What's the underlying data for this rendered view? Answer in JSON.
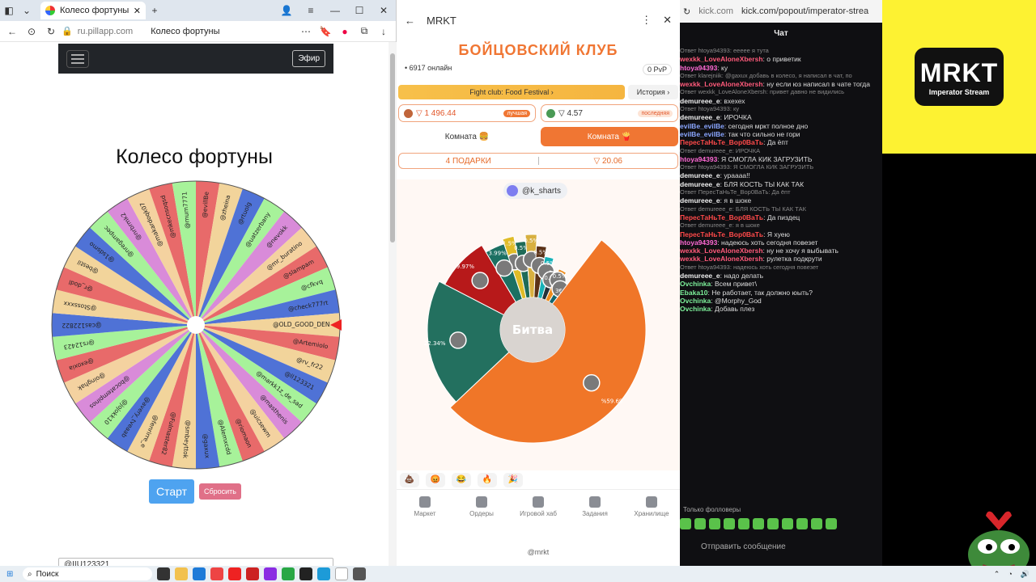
{
  "browser": {
    "tab_title": "Колесо фортуны",
    "address_url": "ru.pillapp.com",
    "address_title": "Колесо фортуны"
  },
  "page": {
    "efir_button": "Эфир",
    "wheel_title": "Колесо фортуны",
    "start_button": "Старт",
    "reset_button": "Сбросить",
    "input_value": "@IIU123321",
    "wheel_names": [
      "@evillBe",
      "@zheina",
      "@rtuolg",
      "@uatzerbany",
      "@nevokk",
      "@mr_buratino",
      "@slampam",
      "@cfkvq",
      "@check777rt",
      "@OLD_GOOD_DEN",
      "@Artemiolo",
      "@rv_fr22",
      "@ll123321",
      "@markk1z_de_sad",
      "@masthenis",
      "@uicsewm",
      "@riomaon",
      "@Alemxcdd",
      "@gaxux",
      "@smbeyttok",
      "@Fulmaster82",
      "@fenrirre_e",
      "@avery_tveaab",
      "@jojokk10",
      "@bocatempinos",
      "@oinghak",
      "@exoxia",
      "@rs12423",
      "@cas122822",
      "@Stossxxx",
      "@r_dodl",
      "@bestil",
      "@1sdsmo",
      "@nregampec",
      "@nrbrmk2",
      "@makardoqk07",
      "@mkecnsoqsd",
      "@mum7771"
    ],
    "wheel_colors": [
      "#e86a6a",
      "#f2d49b",
      "#4f72d6",
      "#a7f29a",
      "#d98bd9",
      "#f4d2a0",
      "#e86a6a",
      "#a7f29a",
      "#4f72d6",
      "#f2d49b"
    ]
  },
  "mrkt": {
    "title": "MRKT",
    "club_title": "БОЙЦОВСКИЙ КЛУБ",
    "online": "• 6917 онлайн",
    "pvp": "0 PvP",
    "promo": "Fight club: Food Festival",
    "history": "История",
    "balance_left": "▽ 1 496.44",
    "balance_left_badge": "лучшая",
    "balance_right": "▽ 4.57",
    "balance_right_badge": "последняя",
    "room_a": "Комната",
    "room_b": "Комната",
    "gifts": "4 ПОДАРКИ",
    "gifts_total": "▽ 20.06",
    "user_tag": "@k_sharts",
    "battle_label": "Битва",
    "segments": [
      {
        "label": "1.5%",
        "color": "#e0bc28",
        "value": 1.5
      },
      {
        "label": "0.5%",
        "color": "#1f6b58",
        "value": 0.5
      },
      {
        "label": "0.5%",
        "color": "#d8b040",
        "value": 0.5
      },
      {
        "label": "0.5%",
        "color": "#5b3217",
        "value": 0.5
      },
      {
        "label": "0.5%",
        "color": "#16b1b7",
        "value": 0.5
      },
      {
        "label": "0.5%",
        "color": "#23323a",
        "value": 0.5
      },
      {
        "label": "0.5%",
        "color": "#ec8c1f",
        "value": 0.5
      },
      {
        "label": "3€",
        "color": "#14676f",
        "value": 0.5
      },
      {
        "label": "%59.69",
        "color": "#f07628",
        "value": 59.69
      },
      {
        "label": "22.34%",
        "color": "#23705f",
        "value": 22.34
      },
      {
        "label": "9.97%",
        "color": "#b7191a",
        "value": 9.97
      },
      {
        "label": "3.99%",
        "color": "#1c7062",
        "value": 3.99
      }
    ],
    "nav": [
      "Маркет",
      "Ордеры",
      "Игровой хаб",
      "Задания",
      "Хранилище"
    ],
    "footer": "@mrkt"
  },
  "chat": {
    "url": "kick.com",
    "url_path": "kick.com/popout/imperator-strea",
    "title": "Чат",
    "lines": [
      {
        "r": true,
        "t": "Ответ htoya94393: ееееe я тута"
      },
      {
        "n": "wexkk_LoveAloneXbersh",
        "c": "#ff5a7a",
        "t": "о приветик"
      },
      {
        "n": "htoya94393",
        "c": "#ff6ad5",
        "t": "ку"
      },
      {
        "r": true,
        "t": "Ответ klarejniik: @gaxux добавь в колесо, я написал в чат, по"
      },
      {
        "n": "wexkk_LoveAloneXbersh",
        "c": "#ff5a7a",
        "t": "ну если юз написал в чате тогда"
      },
      {
        "r": true,
        "t": "Ответ wexkk_LoveAloneXbersh: привет давно не видились"
      },
      {
        "n": "demureee_e",
        "c": "#eee",
        "t": "вхехех"
      },
      {
        "r": true,
        "t": "Ответ htoya94393: ку"
      },
      {
        "n": "demureee_e",
        "c": "#eee",
        "t": "ИРОЧКА"
      },
      {
        "n": "evilBe_evilBe",
        "c": "#8aa6ff",
        "t": "сегодня мркт полное дно"
      },
      {
        "n": "evilBe_evilBe",
        "c": "#8aa6ff",
        "t": "так что сильно не гори"
      },
      {
        "n": "ПересТаНьТе_Вор0ВаТь",
        "c": "#ff4a4a",
        "t": "Да ёпт"
      },
      {
        "r": true,
        "t": "Ответ demureee_e: ИРОЧКА"
      },
      {
        "n": "htoya94393",
        "c": "#ff6ad5",
        "t": "Я СМОГЛА КИК ЗАГРУЗИТЬ"
      },
      {
        "r": true,
        "t": "Ответ htoya94393: Я СМОГЛА КИК ЗАГРУЗИТЬ"
      },
      {
        "n": "demureee_e",
        "c": "#eee",
        "t": "ураааа!!"
      },
      {
        "n": "demureee_e",
        "c": "#eee",
        "t": "БЛЯ КОСТЬ ТЫ КАК ТАК"
      },
      {
        "r": true,
        "t": "Ответ ПересТаНьТе_Вор0ВаТь: Да ёпт"
      },
      {
        "n": "demureee_e",
        "c": "#eee",
        "t": "я в шоке"
      },
      {
        "r": true,
        "t": "Ответ demureee_e: БЛЯ КОСТЬ ТЫ КАК ТАК"
      },
      {
        "n": "ПересТаНьТе_Вор0ВаТь",
        "c": "#ff4a4a",
        "t": "Да пиздец"
      },
      {
        "r": true,
        "t": "Ответ demureee_e: я в шоке"
      },
      {
        "n": "ПересТаНьТе_Вор0ВаТь",
        "c": "#ff4a4a",
        "t": "Я хуею"
      },
      {
        "n": "htoya94393",
        "c": "#ff6ad5",
        "t": "надеюсь хоть сегодня повезет"
      },
      {
        "n": "wexkk_LoveAloneXbersh",
        "c": "#ff5a7a",
        "t": "ну не хочу я выбывать"
      },
      {
        "n": "wexkk_LoveAloneXbersh",
        "c": "#ff5a7a",
        "t": "рулетка подкрути"
      },
      {
        "r": true,
        "t": "Ответ htoya94393: надеюсь хоть сегодня повезет"
      },
      {
        "n": "demureee_e",
        "c": "#eee",
        "t": "надо делать"
      },
      {
        "n": "Ovchinka",
        "c": "#7df09a",
        "t": "Всем привет\\"
      },
      {
        "n": "Ebaka10",
        "c": "#7df09a",
        "t": "Не работает, так должно юыть?"
      },
      {
        "n": "Ovchinka",
        "c": "#7df09a",
        "t": "@Morphy_God"
      },
      {
        "n": "Ovchinka",
        "c": "#7df09a",
        "t": "Добавь плез"
      }
    ],
    "followers_only": "Только фолловеры",
    "send_placeholder": "Отправить сообщение"
  },
  "logo": {
    "title": "MRKT",
    "subtitle": "Imperator Stream"
  },
  "taskbar": {
    "search": "Поиск"
  }
}
